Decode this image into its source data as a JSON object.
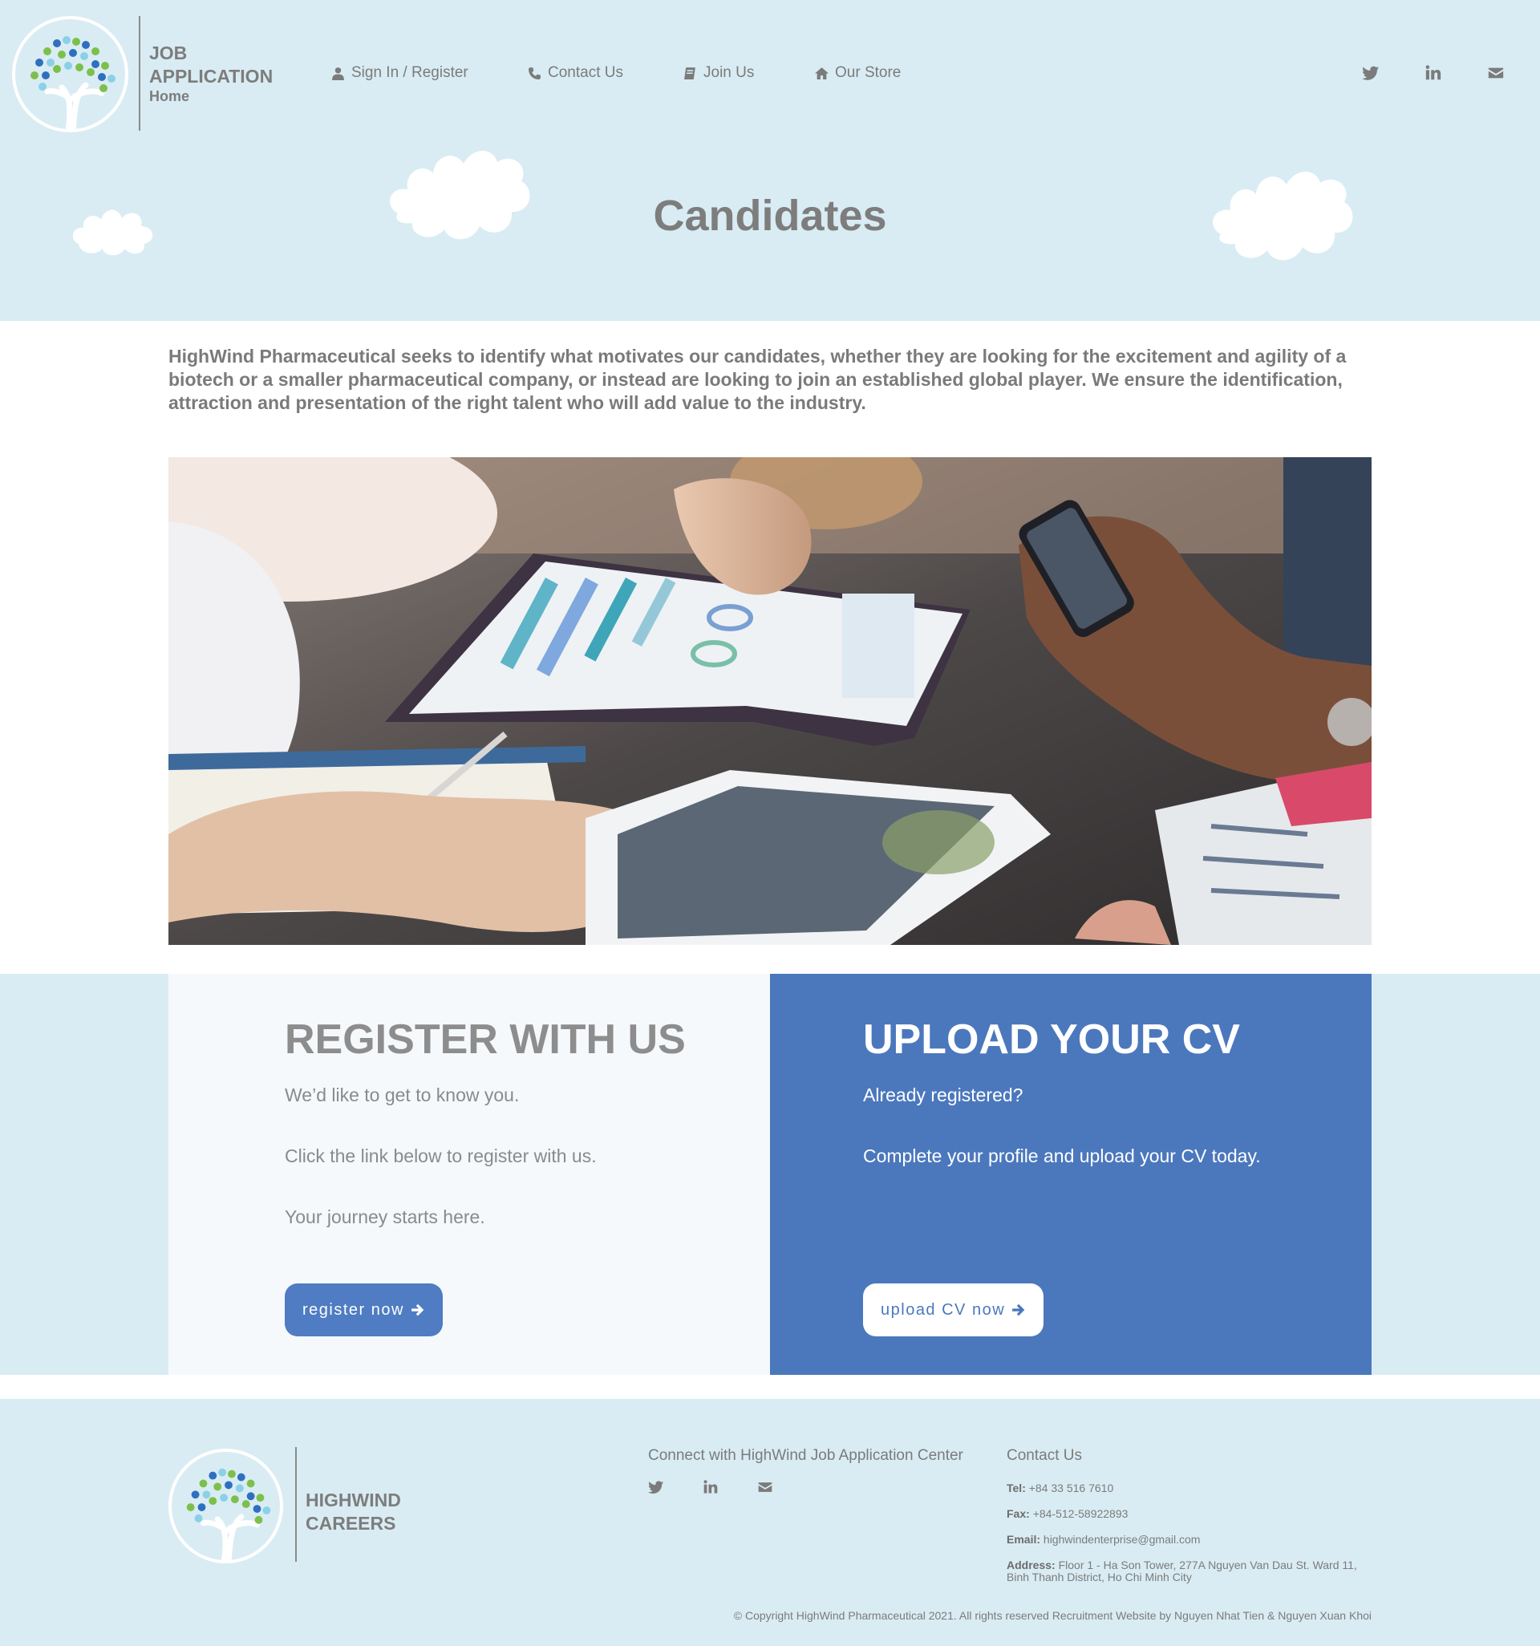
{
  "header": {
    "logo_line1": "JOB",
    "logo_line2": "APPLICATION",
    "home_link": "Home",
    "nav": {
      "signin": "Sign In / Register",
      "contact": "Contact Us",
      "join": "Join Us",
      "store": "Our Store"
    },
    "social_icons": [
      "twitter-icon",
      "linkedin-icon",
      "envelope-icon"
    ]
  },
  "hero": {
    "title": "Candidates"
  },
  "intro": "HighWind Pharmaceutical seeks to identify what motivates our candidates, whether they are looking for the excitement and agility of a biotech or a smaller pharmaceutical company, or instead are looking to join an established global player. We ensure the identification, attraction and presentation of the right talent who will add value to the industry.",
  "register": {
    "title": "REGISTER WITH US",
    "line1": "We’d like to get to know you.",
    "line2": "Click the link below to register with us.",
    "line3": "Your journey starts here.",
    "button": "register now"
  },
  "upload": {
    "title": "UPLOAD YOUR CV",
    "line1": "Already registered?",
    "line2": "Complete your profile and upload your CV today.",
    "button": "upload CV now"
  },
  "footer": {
    "logo_line1": "HIGHWIND",
    "logo_line2": "CAREERS",
    "connect_title": "Connect with HighWind Job Application Center",
    "contact_title": "Contact Us",
    "tel_label": "Tel:",
    "tel": "+84 33 516 7610",
    "fax_label": "Fax:",
    "fax": "+84-512-58922893",
    "email_label": "Email:",
    "email": "highwindenterprise@gmail.com",
    "address_label": "Address:",
    "address": "Floor 1 - Ha Son Tower, 277A Nguyen Van Dau St. Ward 11, Binh Thanh District, Ho Chi Minh City",
    "copyright": "© Copyright HighWind Pharmaceutical 2021. All rights reserved Recruitment Website by Nguyen Nhat Tien & Nguyen Xuan Khoi"
  },
  "colors": {
    "header_bg": "#d9ecf3",
    "accent_blue": "#4b78bd",
    "button_blue": "#4f7cc2",
    "text_grey": "#7a7a7a"
  }
}
